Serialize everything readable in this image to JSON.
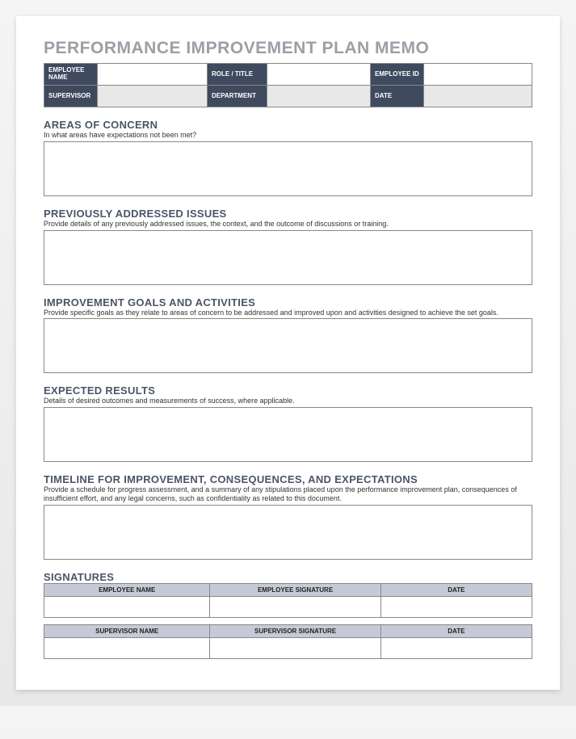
{
  "title": "PERFORMANCE IMPROVEMENT PLAN MEMO",
  "header": {
    "row1": {
      "label1": "EMPLOYEE NAME",
      "label2": "ROLE / TITLE",
      "label3": "EMPLOYEE ID"
    },
    "row2": {
      "label1": "SUPERVISOR",
      "label2": "DEPARTMENT",
      "label3": "DATE"
    }
  },
  "sections": {
    "concern": {
      "title": "AREAS OF CONCERN",
      "desc": "In what areas have expectations not been met?"
    },
    "previous": {
      "title": "PREVIOUSLY ADDRESSED ISSUES",
      "desc": "Provide details of any previously addressed issues, the context, and the outcome of discussions or training."
    },
    "goals": {
      "title": "IMPROVEMENT GOALS AND ACTIVITIES",
      "desc": "Provide specific goals as they relate to areas of concern to be addressed and improved upon and activities designed to achieve the set goals."
    },
    "expected": {
      "title": "EXPECTED RESULTS",
      "desc": "Details of desired outcomes and measurements of success, where applicable."
    },
    "timeline": {
      "title": "TIMELINE FOR IMPROVEMENT, CONSEQUENCES, AND EXPECTATIONS",
      "desc": "Provide a schedule for progress assessment, and a summary of any stipulations placed upon the performance improvement plan, consequences of insufficient effort, and any legal concerns, such as confidentiality as related to this document."
    },
    "signatures": {
      "title": "SIGNATURES"
    }
  },
  "sig": {
    "emp": {
      "name": "EMPLOYEE NAME",
      "sig": "EMPLOYEE SIGNATURE",
      "date": "DATE"
    },
    "sup": {
      "name": "SUPERVISOR NAME",
      "sig": "SUPERVISOR SIGNATURE",
      "date": "DATE"
    }
  }
}
